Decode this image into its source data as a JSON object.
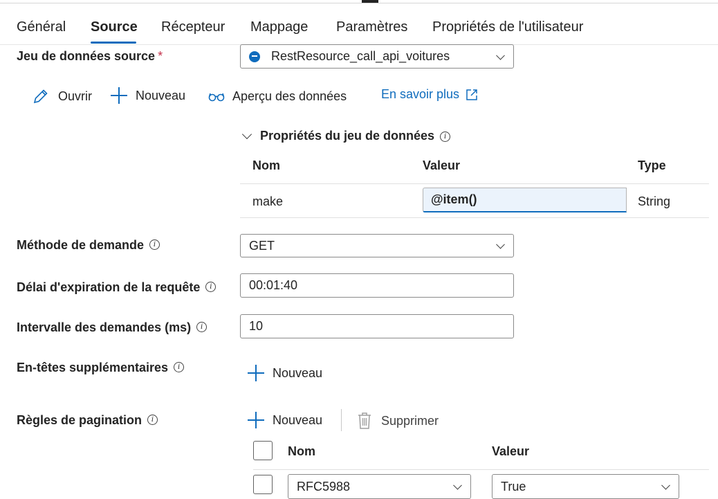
{
  "tabs": [
    {
      "label": "Général"
    },
    {
      "label": "Source"
    },
    {
      "label": "Récepteur"
    },
    {
      "label": "Mappage"
    },
    {
      "label": "Paramètres"
    },
    {
      "label": "Propriétés de l'utilisateur"
    }
  ],
  "active_tab": "Source",
  "source_dataset": {
    "label": "Jeu de données source",
    "required_mark": "*",
    "value": "RestResource_call_api_voitures",
    "icon": "rest-icon"
  },
  "dataset_actions": {
    "open": "Ouvrir",
    "new": "Nouveau",
    "preview": "Aperçu des données",
    "learn_more": "En savoir plus"
  },
  "dataset_properties": {
    "title": "Propriétés du jeu de données",
    "columns": {
      "name": "Nom",
      "value": "Valeur",
      "type": "Type"
    },
    "rows": [
      {
        "name": "make",
        "value": "@item()",
        "type": "String"
      }
    ]
  },
  "request_method": {
    "label": "Méthode de demande",
    "value": "GET"
  },
  "request_timeout": {
    "label": "Délai d'expiration de la requête",
    "value": "00:01:40"
  },
  "request_interval": {
    "label": "Intervalle des demandes (ms)",
    "value": "10"
  },
  "additional_headers": {
    "label": "En-têtes supplémentaires",
    "new": "Nouveau"
  },
  "pagination": {
    "label": "Règles de pagination",
    "new": "Nouveau",
    "delete": "Supprimer",
    "columns": {
      "name": "Nom",
      "value": "Valeur"
    },
    "rows": [
      {
        "name": "RFC5988",
        "value": "True"
      }
    ]
  },
  "colors": {
    "accent": "#0f6cbd",
    "required": "#c4314b",
    "border": "#8a8a8a"
  }
}
